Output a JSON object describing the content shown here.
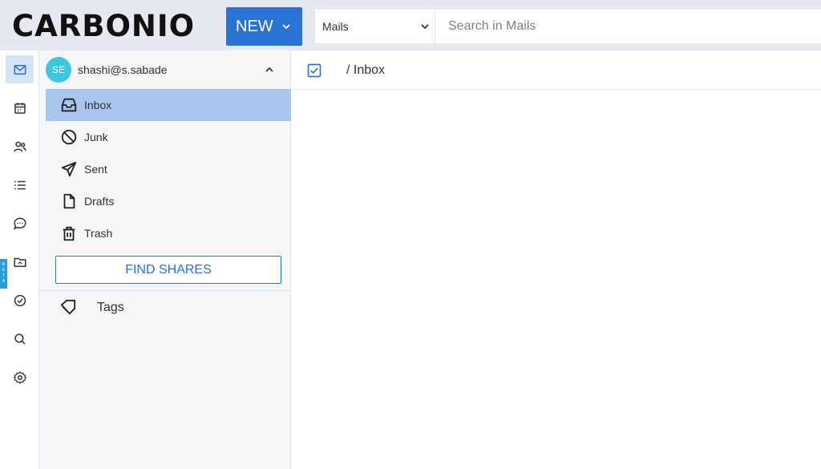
{
  "app": {
    "logo_text": "CARBONIO"
  },
  "header": {
    "new_label": "NEW",
    "module_value": "Mails",
    "search_placeholder": "Search in Mails"
  },
  "rail": {
    "items": [
      {
        "icon": "mail-icon",
        "active": true
      },
      {
        "icon": "calendar-icon",
        "active": false
      },
      {
        "icon": "contacts-icon",
        "active": false
      },
      {
        "icon": "list-icon",
        "active": false
      },
      {
        "icon": "chat-icon",
        "active": false
      },
      {
        "icon": "files-icon",
        "active": false
      },
      {
        "icon": "tasks-icon",
        "active": false
      },
      {
        "icon": "search-icon",
        "active": false
      },
      {
        "icon": "settings-icon",
        "active": false
      }
    ],
    "beta_label": "BETA"
  },
  "sidebar": {
    "account": {
      "initials": "SE",
      "name": "shashi@s.sabade"
    },
    "folders": [
      {
        "label": "Inbox",
        "icon": "inbox-icon",
        "active": true
      },
      {
        "label": "Junk",
        "icon": "junk-icon",
        "active": false
      },
      {
        "label": "Sent",
        "icon": "sent-icon",
        "active": false
      },
      {
        "label": "Drafts",
        "icon": "drafts-icon",
        "active": false
      },
      {
        "label": "Trash",
        "icon": "trash-icon",
        "active": false
      }
    ],
    "find_shares_label": "FIND SHARES",
    "tags_label": "Tags"
  },
  "main": {
    "breadcrumb": "/ Inbox"
  },
  "colors": {
    "accent": "#2b73d2",
    "active_folder": "#aac6ee",
    "topbar": "#e6e9ef",
    "avatar": "#3ec6e0"
  }
}
